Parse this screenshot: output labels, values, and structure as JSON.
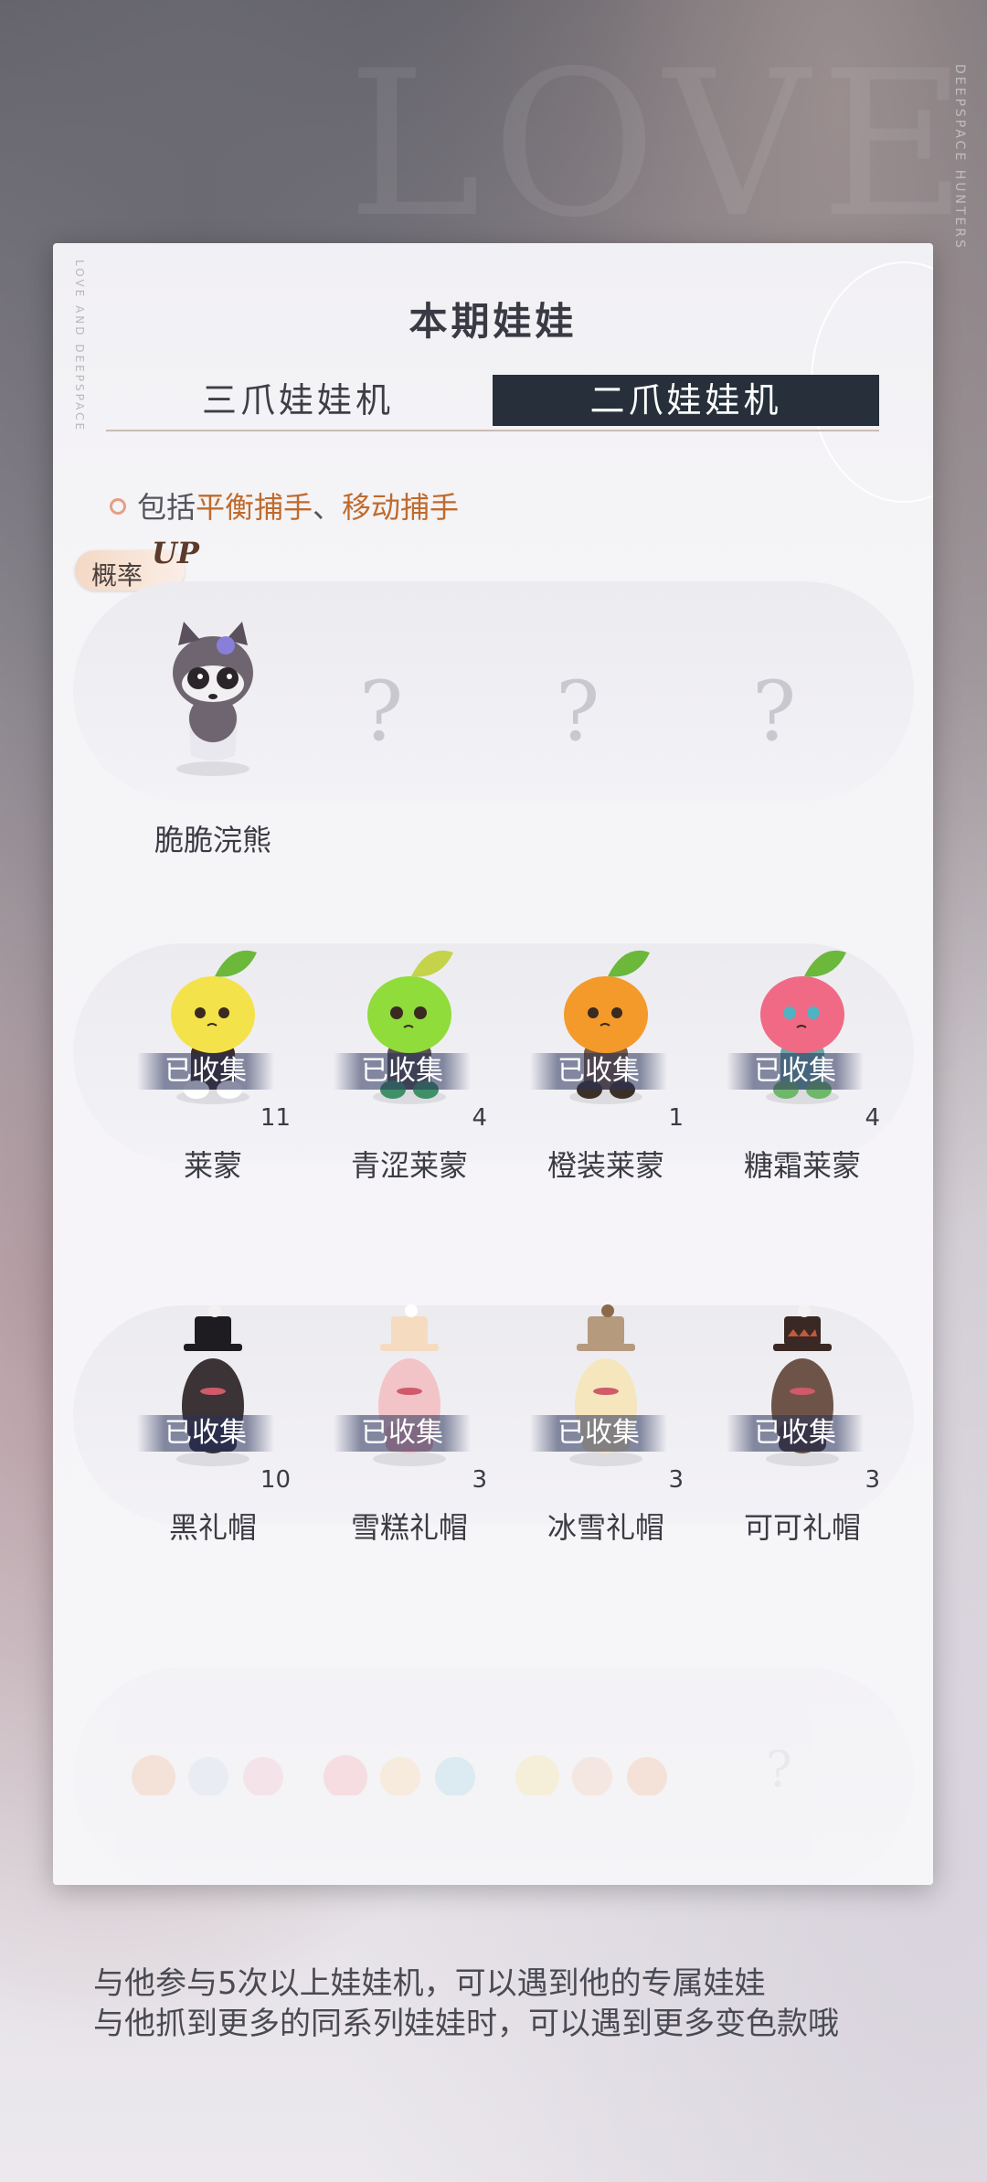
{
  "background": {
    "watermark": "LOVE",
    "side_tag": "DEEPSPACE HUNTERS"
  },
  "panel": {
    "title": "本期娃娃",
    "side_text": "LOVE AND DEEPSPACE",
    "tabs": [
      {
        "label": "三爪娃娃机",
        "active": false
      },
      {
        "label": "二爪娃娃机",
        "active": true
      }
    ],
    "include": {
      "prefix": "包括",
      "item1": "平衡捕手",
      "sep": "、",
      "item2": "移动捕手"
    },
    "prob_badge": {
      "text": "概率",
      "up": "UP"
    }
  },
  "rows": [
    {
      "items": [
        {
          "name": "脆脆浣熊",
          "icon": "raccoon-doll-icon",
          "collected": false,
          "count": ""
        },
        {
          "unknown": "?"
        },
        {
          "unknown": "?"
        },
        {
          "unknown": "?"
        }
      ]
    },
    {
      "items": [
        {
          "name": "莱蒙",
          "icon": "lemon-doll-icon",
          "collected": true,
          "count": "11"
        },
        {
          "name": "青涩莱蒙",
          "icon": "green-lemon-doll-icon",
          "collected": true,
          "count": "4"
        },
        {
          "name": "橙装莱蒙",
          "icon": "orange-lemon-doll-icon",
          "collected": true,
          "count": "1"
        },
        {
          "name": "糖霜莱蒙",
          "icon": "pink-lemon-doll-icon",
          "collected": true,
          "count": "4"
        }
      ]
    },
    {
      "items": [
        {
          "name": "黑礼帽",
          "icon": "black-top-hat-doll-icon",
          "collected": true,
          "count": "10"
        },
        {
          "name": "雪糕礼帽",
          "icon": "pink-top-hat-doll-icon",
          "collected": true,
          "count": "3"
        },
        {
          "name": "冰雪礼帽",
          "icon": "cream-top-hat-doll-icon",
          "collected": true,
          "count": "3"
        },
        {
          "name": "可可礼帽",
          "icon": "cocoa-top-hat-doll-icon",
          "collected": true,
          "count": "3"
        }
      ]
    }
  ],
  "collected_label": "已收集",
  "colors": {
    "tab_active_bg": "#27303a",
    "highlight": "#c06a2c",
    "lemon": "#f4e24a",
    "green_lemon": "#8fdc3a",
    "orange_lemon": "#f39a2a",
    "pink_lemon": "#f06a86"
  },
  "caption": {
    "line1": "与他参与5次以上娃娃机，可以遇到他的专属娃娃",
    "line2": "与他抓到更多的同系列娃娃时，可以遇到更多变色款哦"
  }
}
